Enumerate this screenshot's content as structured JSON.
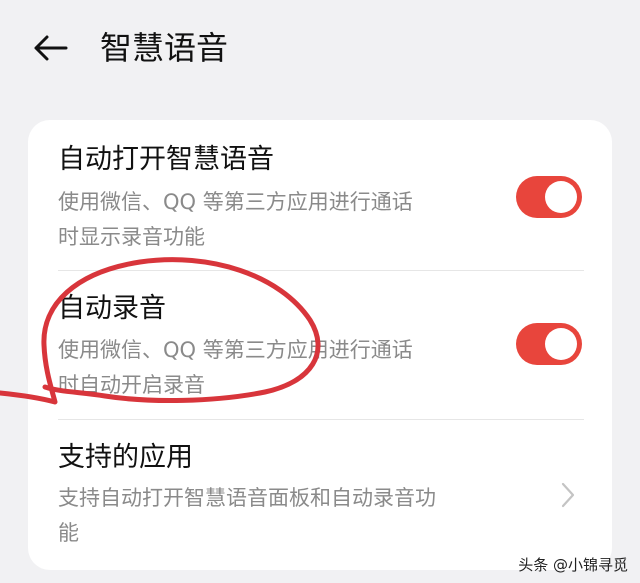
{
  "header": {
    "title": "智慧语音",
    "back_icon": "arrow-left-icon"
  },
  "settings": [
    {
      "title": "自动打开智慧语音",
      "desc_line1": "使用微信、QQ 等第三方应用进行通话",
      "desc_line2": "时显示录音功能",
      "toggle": "on"
    },
    {
      "title": "自动录音",
      "desc_line1": "使用微信、QQ 等第三方应用进行通话",
      "desc_line2": "时自动开启录音",
      "toggle": "on"
    },
    {
      "title": "支持的应用",
      "desc_line1": "支持自动打开智慧语音面板和自动录音功",
      "desc_line2": "能",
      "chevron_icon": "chevron-right-icon"
    }
  ],
  "watermark": {
    "text": "头条 @小锦寻觅"
  },
  "colors": {
    "background": "#f1f1f3",
    "card": "#ffffff",
    "toggle_on": "#e8453c",
    "annotation": "#d8353b",
    "secondary_text": "#8a8a8a"
  }
}
